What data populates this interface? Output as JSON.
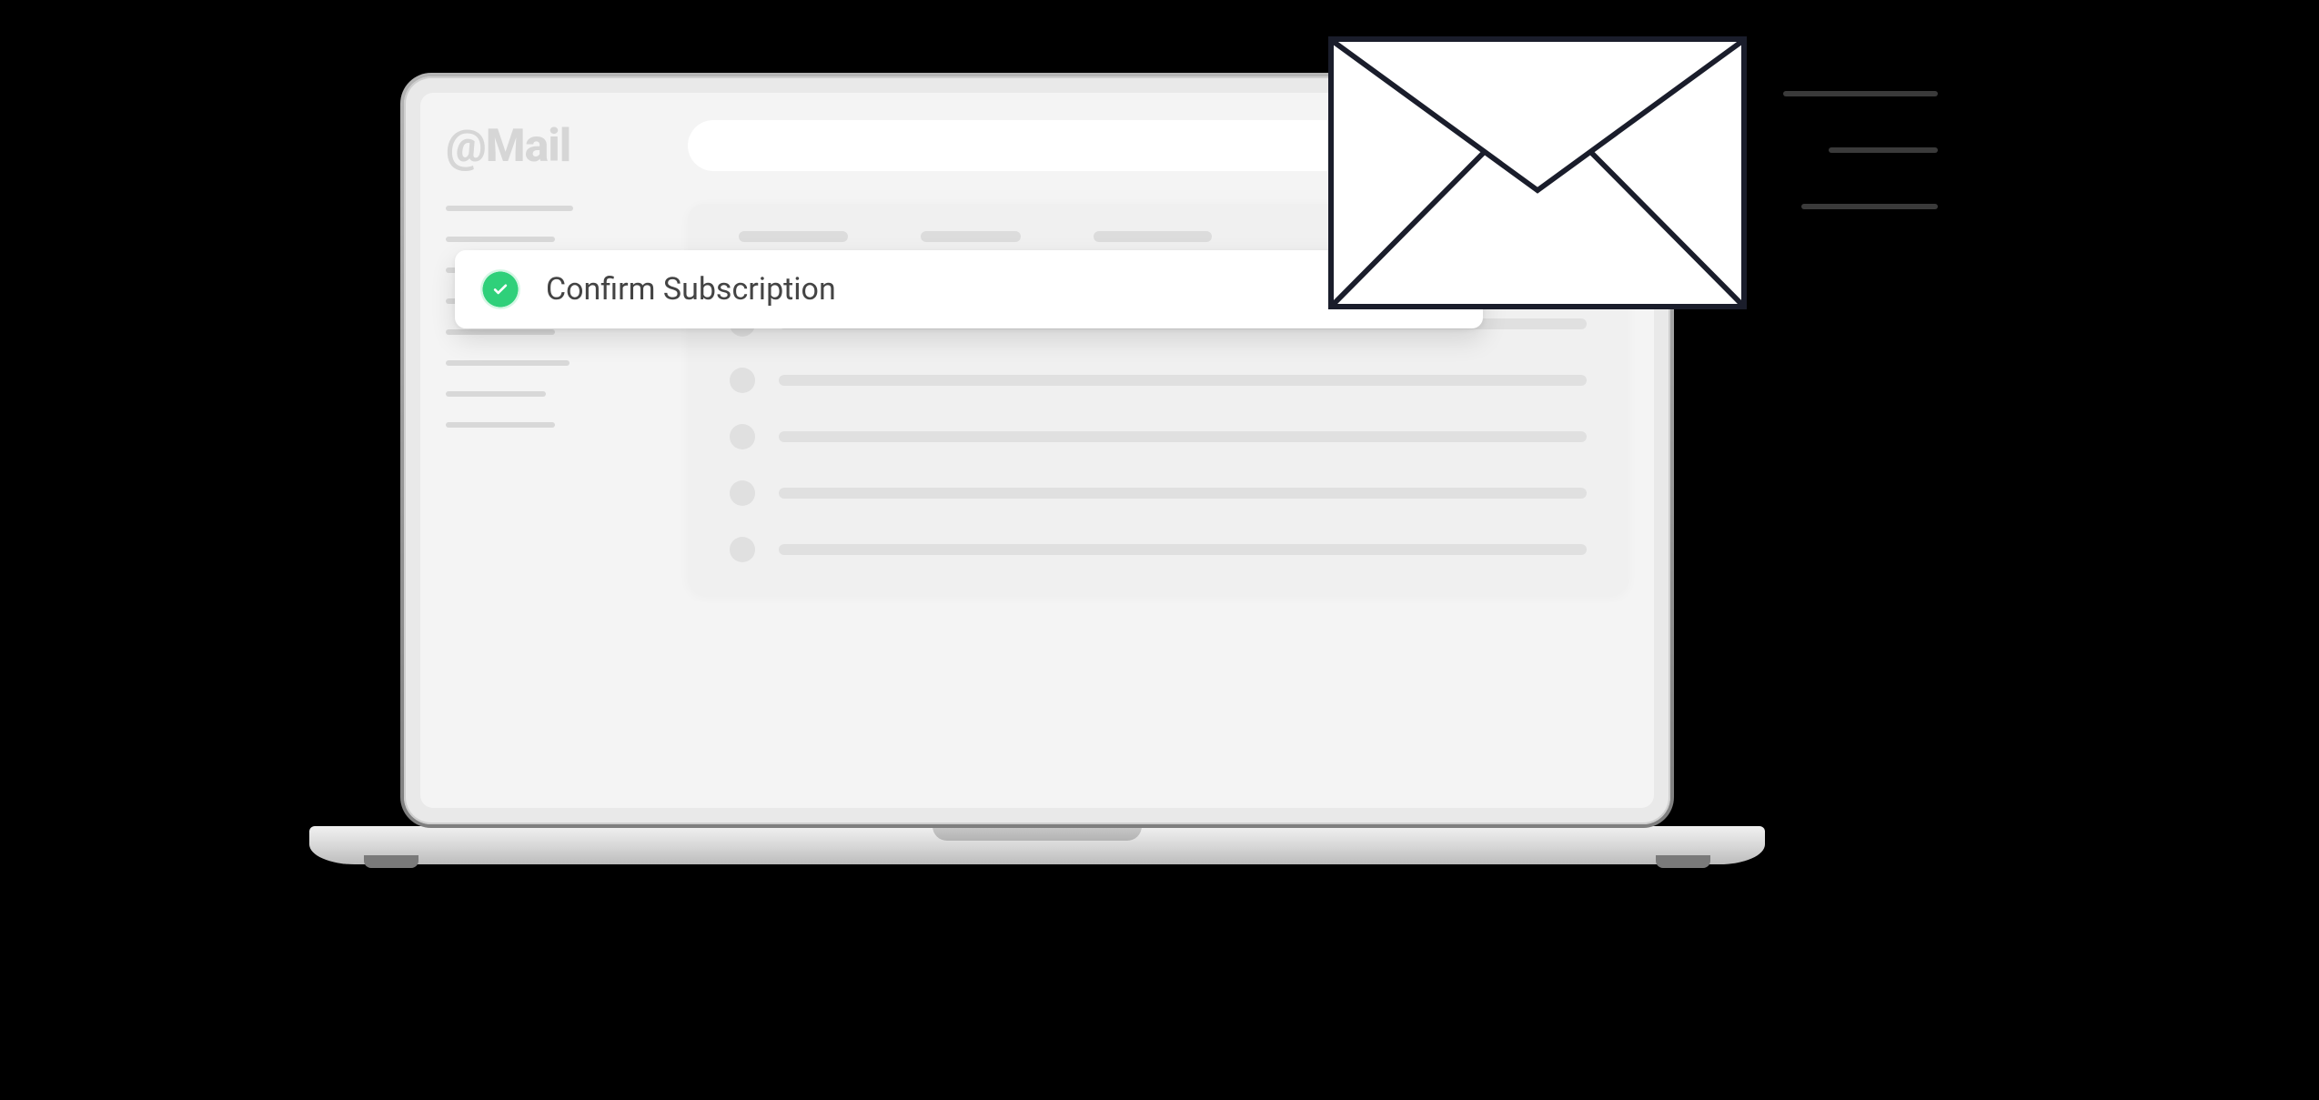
{
  "app": {
    "logo_text": "@Mail"
  },
  "highlighted_email": {
    "subject": "Confirm Subscription",
    "status": "unread-confirmed"
  },
  "colors": {
    "accent_green": "#2fd07a",
    "envelope_stroke": "#1a1d2b",
    "placeholder_grey": "#d8d8d8"
  }
}
